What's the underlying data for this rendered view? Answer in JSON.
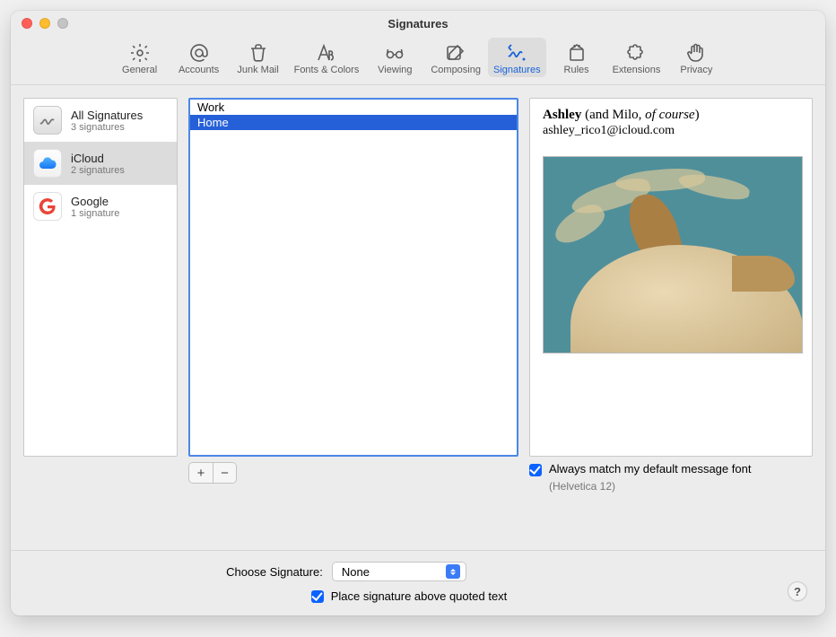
{
  "window": {
    "title": "Signatures"
  },
  "toolbar": {
    "items": [
      {
        "label": "General"
      },
      {
        "label": "Accounts"
      },
      {
        "label": "Junk Mail"
      },
      {
        "label": "Fonts & Colors"
      },
      {
        "label": "Viewing"
      },
      {
        "label": "Composing"
      },
      {
        "label": "Signatures"
      },
      {
        "label": "Rules"
      },
      {
        "label": "Extensions"
      },
      {
        "label": "Privacy"
      }
    ]
  },
  "accounts": [
    {
      "title": "All Signatures",
      "sub": "3 signatures"
    },
    {
      "title": "iCloud",
      "sub": "2 signatures"
    },
    {
      "title": "Google",
      "sub": "1 signature"
    }
  ],
  "signatures": [
    {
      "name": "Work"
    },
    {
      "name": "Home"
    }
  ],
  "preview": {
    "name_bold": "Ashley",
    "name_rest1": " (and Milo, ",
    "name_italic": "of course",
    "name_rest2": ")",
    "email": "ashley_rico1@icloud.com"
  },
  "options": {
    "match_font_label": "Always match my default message font",
    "match_font_sub": "(Helvetica 12)",
    "choose_label": "Choose Signature:",
    "choose_value": "None",
    "place_above_label": "Place signature above quoted text"
  },
  "controls": {
    "add": "+",
    "remove": "−",
    "help": "?"
  }
}
